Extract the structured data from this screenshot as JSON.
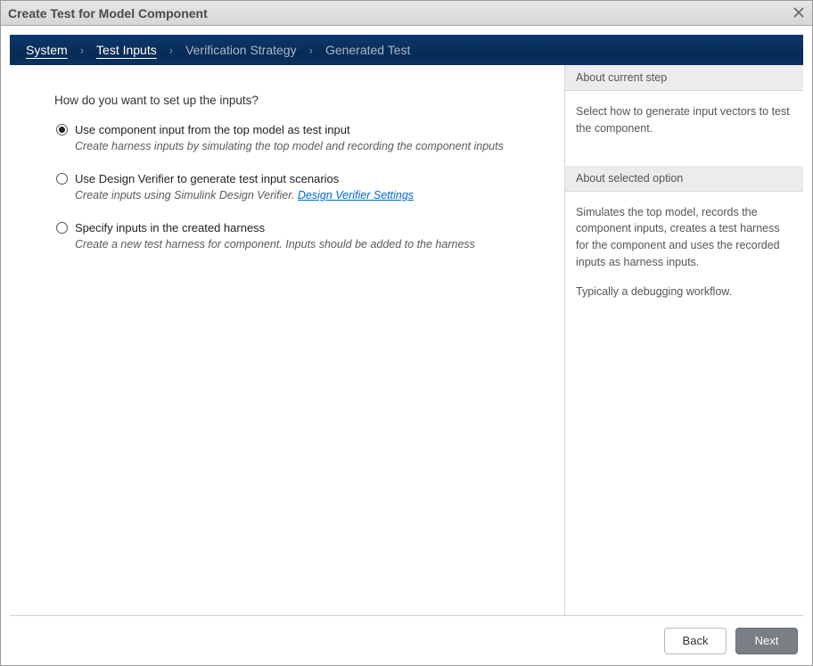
{
  "window": {
    "title": "Create Test for Model Component"
  },
  "stepper": {
    "steps": [
      {
        "label": "System",
        "state": "done"
      },
      {
        "label": "Test Inputs",
        "state": "current"
      },
      {
        "label": "Verification Strategy",
        "state": "future"
      },
      {
        "label": "Generated Test",
        "state": "future"
      }
    ],
    "separator": "›"
  },
  "main": {
    "question": "How do you want to set up the inputs?",
    "options": [
      {
        "id": "use-top-model",
        "label": "Use component input from the top model as test input",
        "desc": "Create harness inputs by simulating the top model and recording the component inputs",
        "selected": true
      },
      {
        "id": "use-design-verifier",
        "label": "Use Design Verifier to generate test input scenarios",
        "desc_prefix": "Create inputs using Simulink Design Verifier. ",
        "link_text": "Design Verifier Settings",
        "selected": false
      },
      {
        "id": "specify-inputs",
        "label": "Specify inputs in the created harness",
        "desc": "Create a new test harness for component. Inputs should be added to the harness",
        "selected": false
      }
    ]
  },
  "side": {
    "step_header": "About current step",
    "step_body": "Select how to generate input vectors to test the component.",
    "option_header": "About selected option",
    "option_body_1": "Simulates the top model, records the component inputs, creates a test harness for the component and uses the recorded inputs as harness inputs.",
    "option_body_2": "Typically a debugging workflow."
  },
  "footer": {
    "back": "Back",
    "next": "Next"
  }
}
